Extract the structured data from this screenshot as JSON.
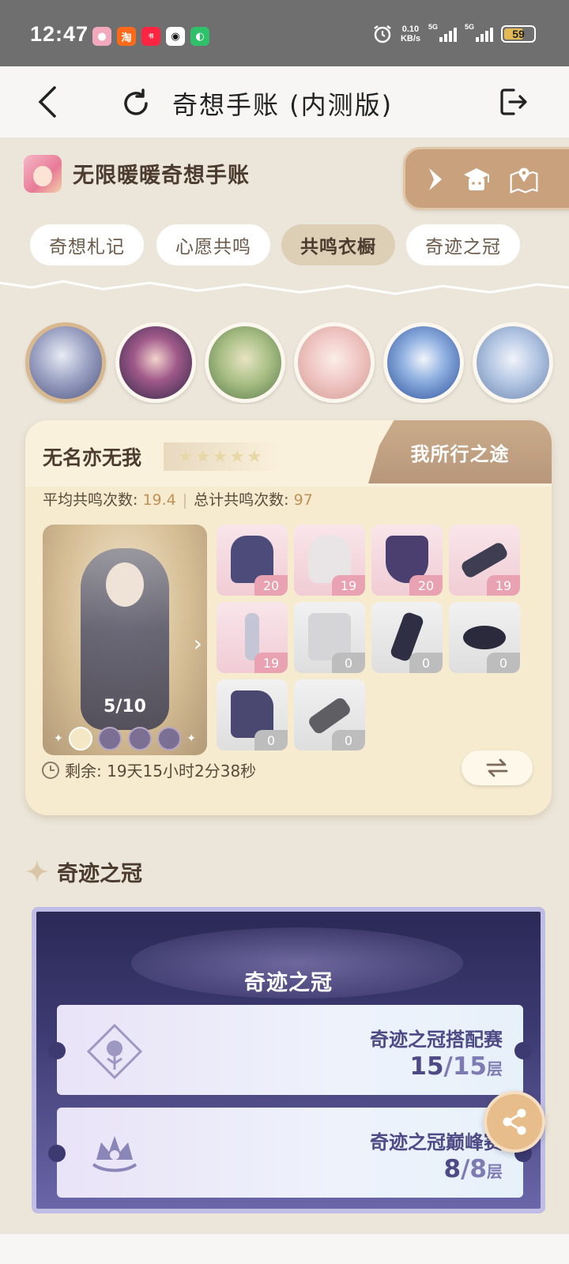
{
  "status_bar": {
    "time": "12:47",
    "net_speed_value": "0.10",
    "net_speed_unit": "KB/s",
    "signal_1_label": "5G",
    "signal_2_label": "5G",
    "battery": "59",
    "app_icons": [
      "game-app-icon",
      "taobao-icon",
      "xiaohongshu-icon",
      "qq-icon",
      "wechat-icon"
    ]
  },
  "nav": {
    "title": "奇想手账 (内测版)"
  },
  "header": {
    "game_title": "无限暖暖奇想手账"
  },
  "tabs": [
    {
      "label": "奇想札记",
      "active": false
    },
    {
      "label": "心愿共鸣",
      "active": false
    },
    {
      "label": "共鸣衣橱",
      "active": true
    },
    {
      "label": "奇迹之冠",
      "active": false
    }
  ],
  "characters": [
    {
      "name": "character-1",
      "selected": true,
      "color": "#7e86ad"
    },
    {
      "name": "character-2",
      "selected": false,
      "color": "#5a3c6e"
    },
    {
      "name": "character-3",
      "selected": false,
      "color": "#a9bf86"
    },
    {
      "name": "character-4",
      "selected": false,
      "color": "#f0c7c5"
    },
    {
      "name": "character-5",
      "selected": false,
      "color": "#5f86c8"
    },
    {
      "name": "character-6",
      "selected": false,
      "color": "#b3c6e3"
    }
  ],
  "suit": {
    "name": "无名亦无我",
    "path_tab": "我所行之途",
    "avg_label": "平均共鸣次数: ",
    "avg_value": "19.4",
    "total_label": "总计共鸣次数: ",
    "total_value": "97",
    "progress": "5/10",
    "remaining": "剩余: 19天15小时2分38秒",
    "items": [
      {
        "count": "20",
        "style": "pink",
        "color": "#4d4b7a"
      },
      {
        "count": "19",
        "style": "pink",
        "color": "#e9e5e6"
      },
      {
        "count": "20",
        "style": "pink",
        "color": "#4a3f6e"
      },
      {
        "count": "19",
        "style": "pink",
        "color": "#3e3d52"
      },
      {
        "count": "19",
        "style": "pink",
        "color": "#c4c6d6"
      },
      {
        "count": "0",
        "style": "gray",
        "color": "#d5d5d8"
      },
      {
        "count": "0",
        "style": "gray",
        "color": "#2f2e45"
      },
      {
        "count": "0",
        "style": "gray",
        "color": "#2b2a3c"
      },
      {
        "count": "0",
        "style": "gray",
        "color": "#4a4770"
      },
      {
        "count": "0",
        "style": "gray",
        "color": "#5f5f63"
      }
    ]
  },
  "crown": {
    "section_title": "奇迹之冠",
    "card_title": "奇迹之冠",
    "entries": [
      {
        "name": "奇迹之冠搭配赛",
        "done": "15",
        "total": "/15",
        "unit": "层"
      },
      {
        "name": "奇迹之冠巅峰赛",
        "done": "8",
        "total": "/8",
        "unit": "层"
      }
    ]
  }
}
